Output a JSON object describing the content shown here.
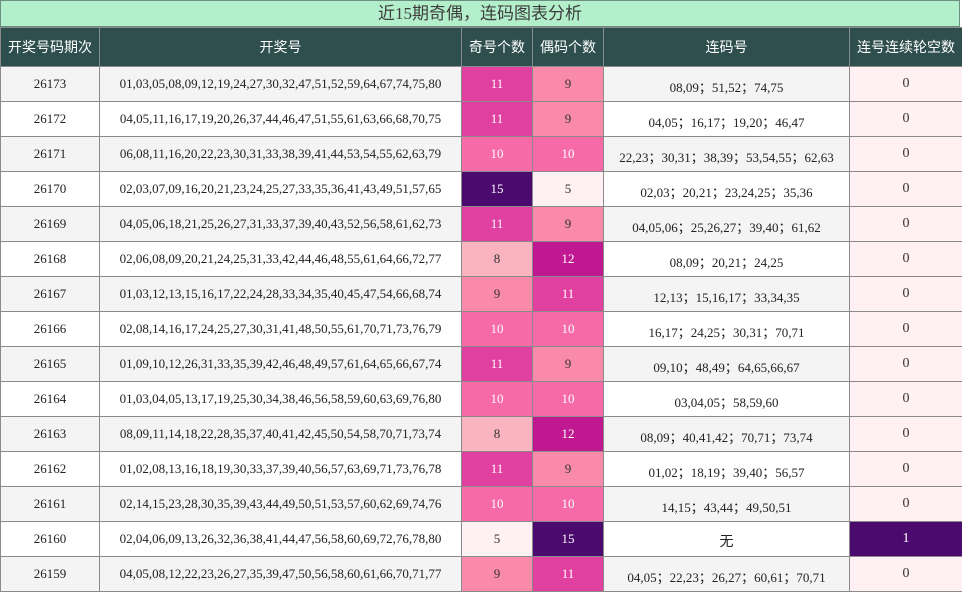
{
  "title": "近15期奇偶，连码图表分析",
  "headers": [
    "开奖号码期次",
    "开奖号",
    "奇号个数",
    "偶码个数",
    "连码号",
    "连号连续轮空数"
  ],
  "colors": {
    "header_bg": "#2f4f4f",
    "title_bg": "#b4efcb",
    "count_5": "#fff0f3",
    "count_8": "#f9b4c0",
    "count_9": "#f98aaa",
    "count_10": "#f56aa7",
    "count_11": "#e040a0",
    "count_12": "#c01890",
    "count_15": "#4b0a6e",
    "kong_0": "#fff1f3",
    "kong_1": "#4b0a6e"
  },
  "rows": [
    {
      "issue": "26173",
      "numbers": "01,03,05,08,09,12,19,24,27,30,32,47,51,52,59,64,67,74,75,80",
      "odd": 11,
      "even": 9,
      "lian": "08,09；51,52；74,75",
      "kong": 0
    },
    {
      "issue": "26172",
      "numbers": "04,05,11,16,17,19,20,26,37,44,46,47,51,55,61,63,66,68,70,75",
      "odd": 11,
      "even": 9,
      "lian": "04,05；16,17；19,20；46,47",
      "kong": 0
    },
    {
      "issue": "26171",
      "numbers": "06,08,11,16,20,22,23,30,31,33,38,39,41,44,53,54,55,62,63,79",
      "odd": 10,
      "even": 10,
      "lian": "22,23；30,31；38,39；53,54,55；62,63",
      "kong": 0
    },
    {
      "issue": "26170",
      "numbers": "02,03,07,09,16,20,21,23,24,25,27,33,35,36,41,43,49,51,57,65",
      "odd": 15,
      "even": 5,
      "lian": "02,03；20,21；23,24,25；35,36",
      "kong": 0
    },
    {
      "issue": "26169",
      "numbers": "04,05,06,18,21,25,26,27,31,33,37,39,40,43,52,56,58,61,62,73",
      "odd": 11,
      "even": 9,
      "lian": "04,05,06；25,26,27；39,40；61,62",
      "kong": 0
    },
    {
      "issue": "26168",
      "numbers": "02,06,08,09,20,21,24,25,31,33,42,44,46,48,55,61,64,66,72,77",
      "odd": 8,
      "even": 12,
      "lian": "08,09；20,21；24,25",
      "kong": 0
    },
    {
      "issue": "26167",
      "numbers": "01,03,12,13,15,16,17,22,24,28,33,34,35,40,45,47,54,66,68,74",
      "odd": 9,
      "even": 11,
      "lian": "12,13；15,16,17；33,34,35",
      "kong": 0
    },
    {
      "issue": "26166",
      "numbers": "02,08,14,16,17,24,25,27,30,31,41,48,50,55,61,70,71,73,76,79",
      "odd": 10,
      "even": 10,
      "lian": "16,17；24,25；30,31；70,71",
      "kong": 0
    },
    {
      "issue": "26165",
      "numbers": "01,09,10,12,26,31,33,35,39,42,46,48,49,57,61,64,65,66,67,74",
      "odd": 11,
      "even": 9,
      "lian": "09,10；48,49；64,65,66,67",
      "kong": 0
    },
    {
      "issue": "26164",
      "numbers": "01,03,04,05,13,17,19,25,30,34,38,46,56,58,59,60,63,69,76,80",
      "odd": 10,
      "even": 10,
      "lian": "03,04,05；58,59,60",
      "kong": 0
    },
    {
      "issue": "26163",
      "numbers": "08,09,11,14,18,22,28,35,37,40,41,42,45,50,54,58,70,71,73,74",
      "odd": 8,
      "even": 12,
      "lian": "08,09；40,41,42；70,71；73,74",
      "kong": 0
    },
    {
      "issue": "26162",
      "numbers": "01,02,08,13,16,18,19,30,33,37,39,40,56,57,63,69,71,73,76,78",
      "odd": 11,
      "even": 9,
      "lian": "01,02；18,19；39,40；56,57",
      "kong": 0
    },
    {
      "issue": "26161",
      "numbers": "02,14,15,23,28,30,35,39,43,44,49,50,51,53,57,60,62,69,74,76",
      "odd": 10,
      "even": 10,
      "lian": "14,15；43,44；49,50,51",
      "kong": 0
    },
    {
      "issue": "26160",
      "numbers": "02,04,06,09,13,26,32,36,38,41,44,47,56,58,60,69,72,76,78,80",
      "odd": 5,
      "even": 15,
      "lian": "无",
      "kong": 1
    },
    {
      "issue": "26159",
      "numbers": "04,05,08,12,22,23,26,27,35,39,47,50,56,58,60,61,66,70,71,77",
      "odd": 9,
      "even": 11,
      "lian": "04,05；22,23；26,27；60,61；70,71",
      "kong": 0
    }
  ]
}
